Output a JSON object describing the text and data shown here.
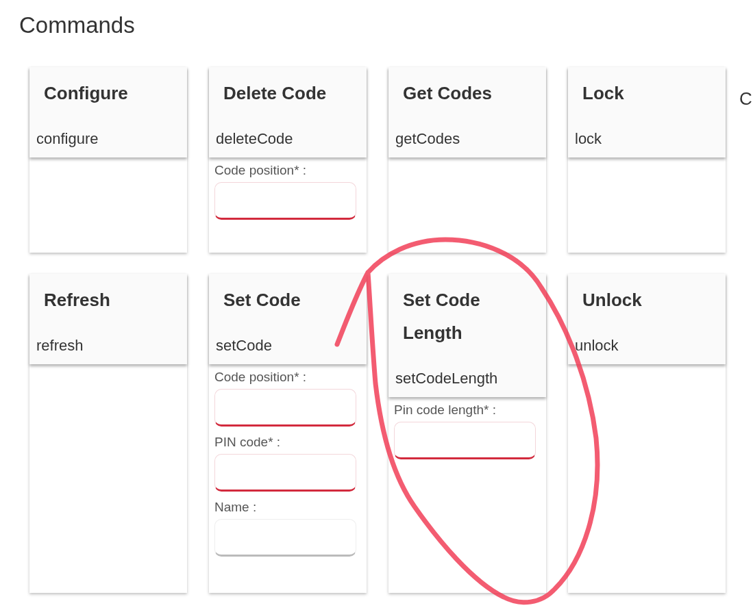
{
  "title": "Commands",
  "cards": [
    {
      "title": "Configure",
      "command": "configure"
    },
    {
      "title": "Delete Code",
      "command": "deleteCode",
      "fields": [
        {
          "label": "Code position* :",
          "required": true
        }
      ]
    },
    {
      "title": "Get Codes",
      "command": "getCodes"
    },
    {
      "title": "Lock",
      "command": "lock"
    },
    {
      "title": "Refresh",
      "command": "refresh"
    },
    {
      "title": "Set Code",
      "command": "setCode",
      "fields": [
        {
          "label": "Code position* :",
          "required": true
        },
        {
          "label": "PIN code* :",
          "required": true
        },
        {
          "label": "Name :",
          "required": false
        }
      ]
    },
    {
      "title": "Set Code Length",
      "command": "setCodeLength",
      "fields": [
        {
          "label": "Pin code length* :",
          "required": true
        }
      ]
    },
    {
      "title": "Unlock",
      "command": "unlock"
    }
  ],
  "cut_off_title": "C",
  "annotation": {
    "kind": "freehand-circle"
  }
}
